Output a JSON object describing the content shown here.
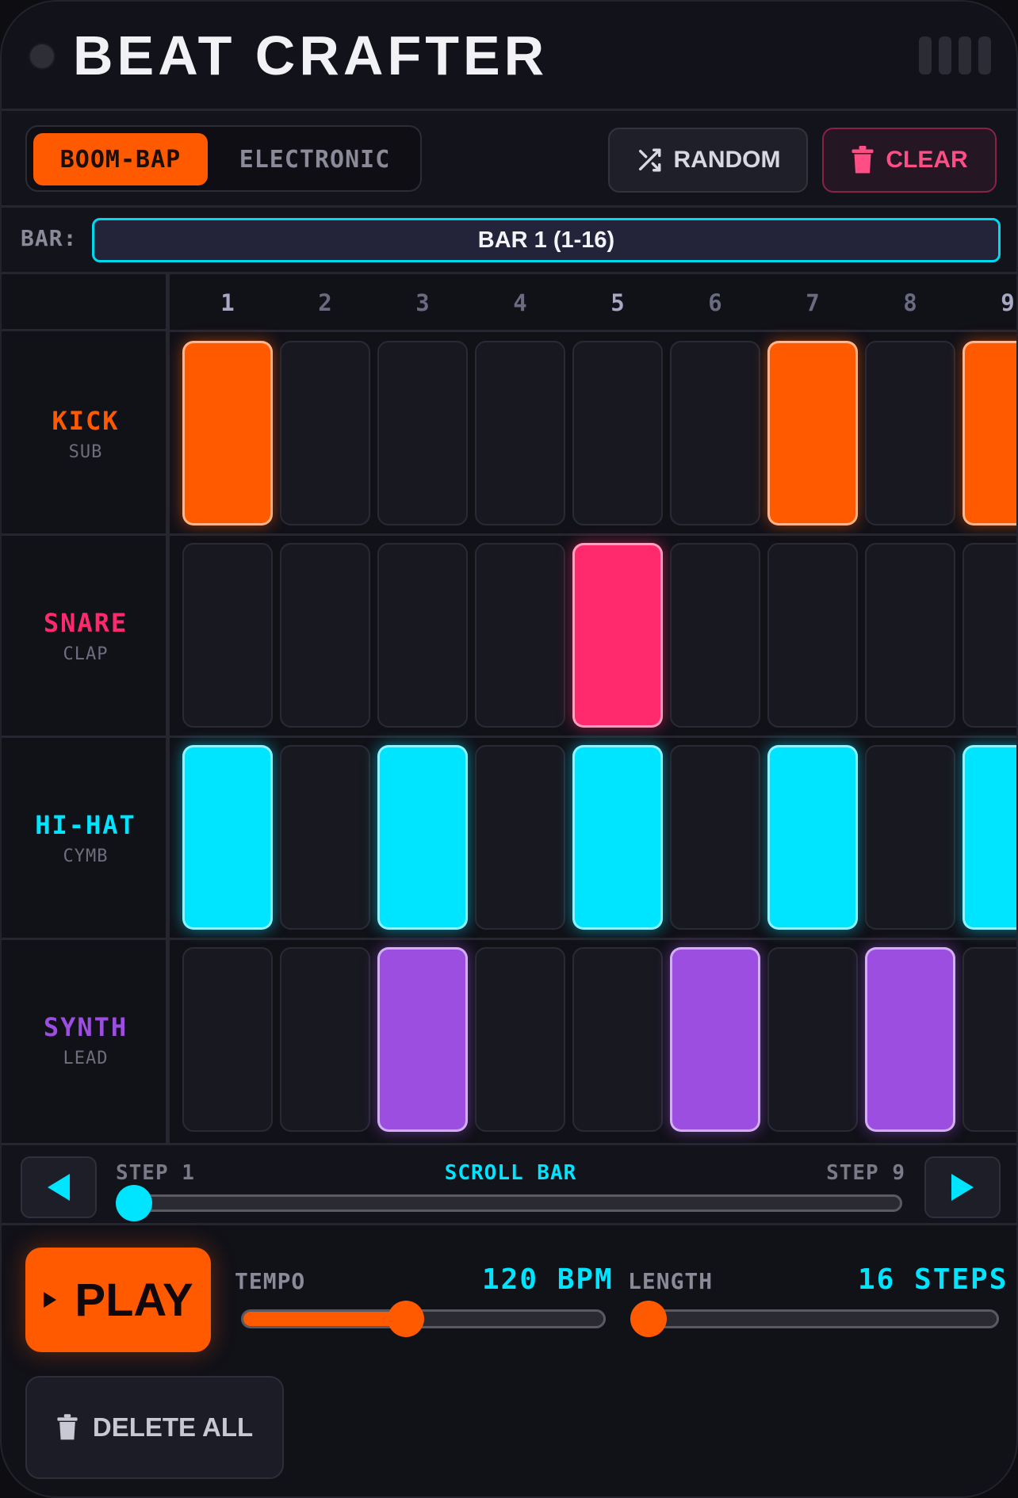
{
  "app": {
    "title": "BEAT CRAFTER"
  },
  "toolbar": {
    "modes": [
      {
        "label": "BOOM-BAP",
        "active": true
      },
      {
        "label": "ELECTRONIC",
        "active": false
      }
    ],
    "random_label": "RANDOM",
    "clear_label": "CLEAR"
  },
  "bar": {
    "label": "BAR:",
    "selected": "BAR 1 (1-16)"
  },
  "steps": [
    "1",
    "2",
    "3",
    "4",
    "5",
    "6",
    "7",
    "8",
    "9"
  ],
  "tracks": [
    {
      "name": "KICK",
      "sub": "SUB",
      "color": "#ff5a00",
      "pattern": [
        1,
        0,
        0,
        0,
        0,
        0,
        1,
        0,
        1
      ]
    },
    {
      "name": "SNARE",
      "sub": "CLAP",
      "color": "#ff2a6e",
      "pattern": [
        0,
        0,
        0,
        0,
        1,
        0,
        0,
        0,
        0
      ]
    },
    {
      "name": "HI-HAT",
      "sub": "CYMB",
      "color": "#00e5ff",
      "pattern": [
        1,
        0,
        1,
        0,
        1,
        0,
        1,
        0,
        1
      ]
    },
    {
      "name": "SYNTH",
      "sub": "LEAD",
      "color": "#9b4ee0",
      "pattern": [
        0,
        0,
        1,
        0,
        0,
        1,
        0,
        1,
        0
      ]
    }
  ],
  "scroll": {
    "start_label": "STEP 1",
    "center_label": "SCROLL BAR",
    "end_label": "STEP 9",
    "position": 0
  },
  "transport": {
    "play_label": "PLAY",
    "tempo_label": "TEMPO",
    "tempo_value": "120 BPM",
    "tempo_fraction": 0.44,
    "length_label": "LENGTH",
    "length_value": "16 STEPS",
    "length_fraction": 0.0,
    "delete_all_label": "DELETE ALL"
  },
  "colors": {
    "accent": "#ff5a00",
    "cyan": "#00e5ff",
    "danger": "#ff4d86"
  }
}
